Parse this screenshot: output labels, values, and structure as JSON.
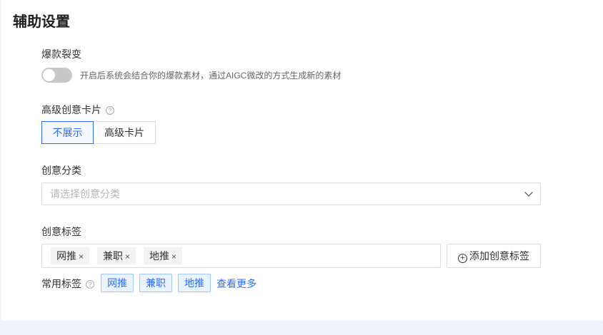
{
  "title": "辅助设置",
  "viral": {
    "label": "爆款裂变",
    "enabled": false,
    "description": "开启后系统会结合你的爆款素材，通过AIGC微改的方式生成新的素材"
  },
  "advanced_card": {
    "label": "高级创意卡片",
    "help_icon": "question-circle-icon",
    "options": [
      "不展示",
      "高级卡片"
    ],
    "selected": "不展示"
  },
  "category": {
    "label": "创意分类",
    "placeholder": "请选择创意分类"
  },
  "tags": {
    "label": "创意标签",
    "selected": [
      "网推",
      "兼职",
      "地推"
    ],
    "remove_glyph": "×",
    "add_button": "添加创意标签"
  },
  "common_tags": {
    "label": "常用标签",
    "items": [
      "网推",
      "兼职",
      "地推"
    ],
    "more_link": "查看更多"
  },
  "colors": {
    "accent": "#2f6bff",
    "background": "#f0f3fa"
  }
}
